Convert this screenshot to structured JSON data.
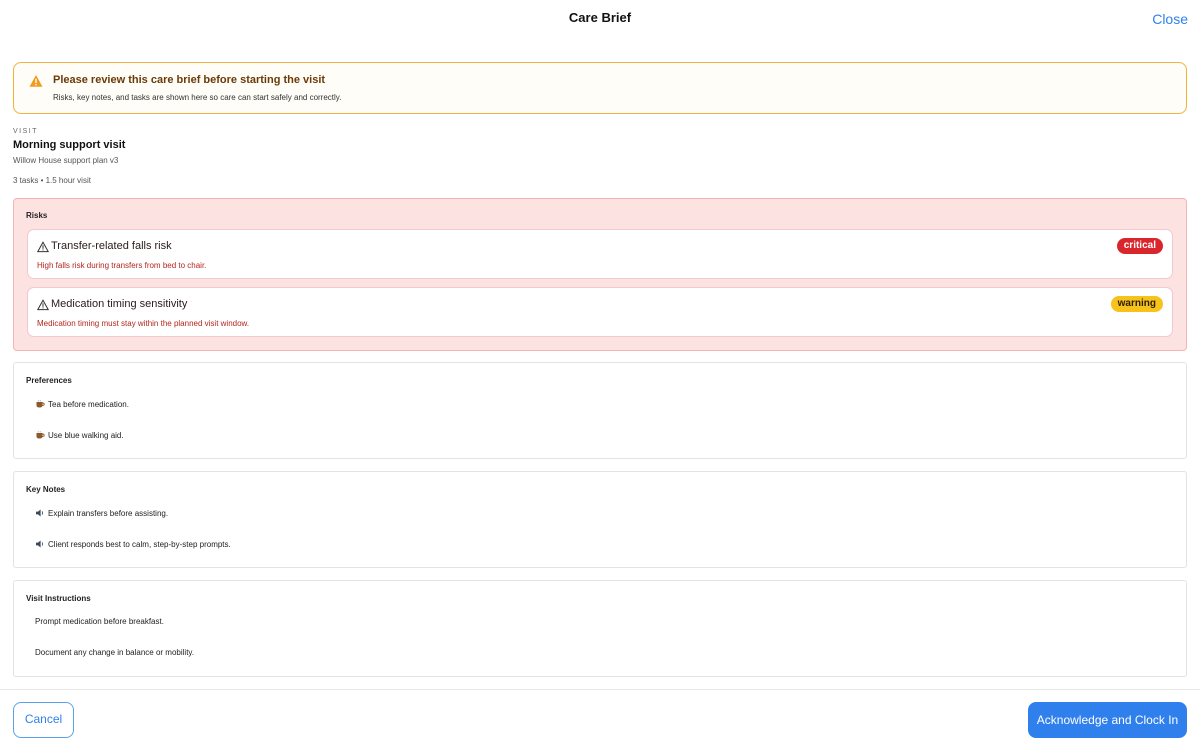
{
  "header": {
    "title": "Care Brief",
    "close_label": "Close"
  },
  "banner": {
    "title": "Please review this care brief before starting the visit",
    "subtitle": "Risks, key notes, and tasks are shown here so care can start safely and correctly.",
    "icon": "warning-triangle-icon",
    "border_color": "#f2b13a"
  },
  "visit": {
    "kicker": "VISIT",
    "title": "Morning support visit",
    "plan": "Willow House support plan v3",
    "meta": "3 tasks • 1.5 hour visit"
  },
  "risks": {
    "heading": "Risks",
    "items": [
      {
        "title": "Transfer-related falls risk",
        "description": "High falls risk during transfers from bed to chair.",
        "badge": "critical",
        "badge_color": "#d9252c"
      },
      {
        "title": "Medication timing sensitivity",
        "description": "Medication timing must stay within the planned visit window.",
        "badge": "warning",
        "badge_color": "#f6c21b"
      }
    ]
  },
  "preferences": {
    "heading": "Preferences",
    "icon": "cup-icon",
    "items": [
      "Tea before medication.",
      "Use blue walking aid."
    ]
  },
  "key_notes": {
    "heading": "Key Notes",
    "icon": "speaker-icon",
    "items": [
      "Explain transfers before assisting.",
      "Client responds best to calm, step-by-step prompts."
    ]
  },
  "instructions": {
    "heading": "Visit Instructions",
    "items": [
      "Prompt medication before breakfast.",
      "Document any change in balance or mobility."
    ]
  },
  "footer": {
    "cancel_label": "Cancel",
    "acknowledge_label": "Acknowledge and Clock In",
    "accent_color": "#2f80ed"
  }
}
